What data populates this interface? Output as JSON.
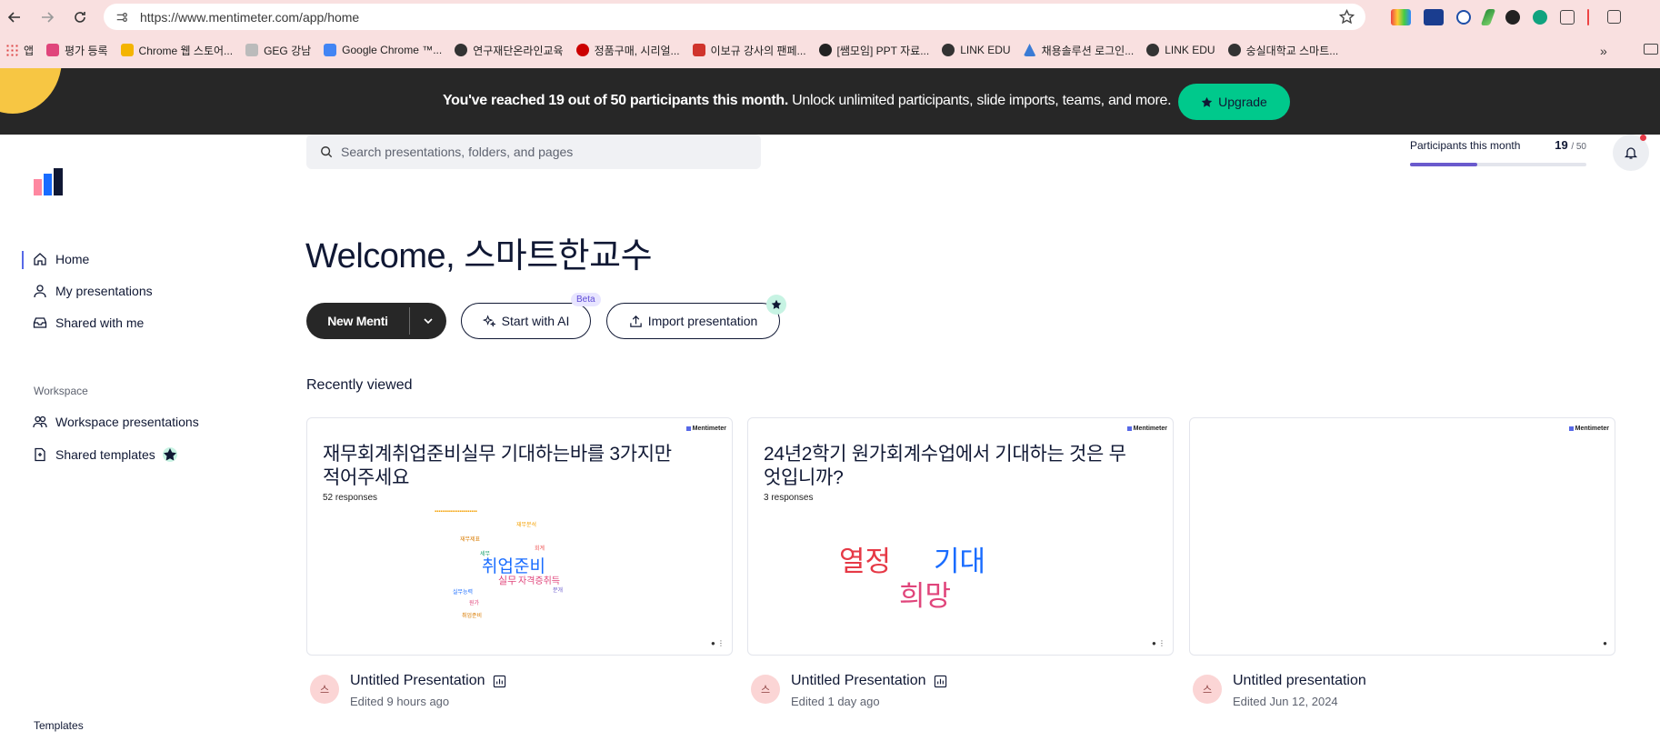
{
  "browser": {
    "url": "https://www.mentimeter.com/app/home",
    "bookmarks": [
      {
        "label": "앱",
        "color": "#d44"
      },
      {
        "label": "평가 등록",
        "color": "#e0457b"
      },
      {
        "label": "Chrome 웹 스토어...",
        "color": "#f4b400"
      },
      {
        "label": "GEG 강남",
        "color": "#bbbbbb"
      },
      {
        "label": "Google Chrome ™...",
        "color": "#4285f4"
      },
      {
        "label": "연구재단온라인교육",
        "color": "#333333"
      },
      {
        "label": "정품구매, 시리얼...",
        "color": "#cc0000"
      },
      {
        "label": "이보규 강사의 팬페...",
        "color": "#d0342c"
      },
      {
        "label": "[쌤모임] PPT 자료...",
        "color": "#222222"
      },
      {
        "label": "LINK EDU",
        "color": "#333333"
      },
      {
        "label": "채용솔루션 로그인...",
        "color": "#3a7bd5"
      },
      {
        "label": "LINK EDU",
        "color": "#333333"
      },
      {
        "label": "숭실대학교 스마트...",
        "color": "#333333"
      }
    ],
    "more_label": "»"
  },
  "banner": {
    "message_bold": "You've reached 19 out of 50 participants this month.",
    "message_rest": " Unlock unlimited participants, slide imports, teams, and more.",
    "upgrade_label": "Upgrade"
  },
  "sidebar": {
    "items": [
      {
        "label": "Home",
        "icon": "home-icon"
      },
      {
        "label": "My presentations",
        "icon": "user-icon"
      },
      {
        "label": "Shared with me",
        "icon": "inbox-icon"
      }
    ],
    "workspace_heading": "Workspace",
    "workspace_items": [
      {
        "label": "Workspace presentations",
        "icon": "users-icon"
      },
      {
        "label": "Shared templates",
        "icon": "document-icon"
      }
    ],
    "templates_heading": "Templates"
  },
  "search": {
    "placeholder": "Search presentations, folders, and pages"
  },
  "participants": {
    "label": "Participants this month",
    "count": "19",
    "limit": "/ 50",
    "fraction": 0.38
  },
  "main": {
    "welcome": "Welcome, 스마트한교수",
    "new_menti_label": "New Menti",
    "start_ai_label": "Start with AI",
    "beta_label": "Beta",
    "import_label": "Import presentation",
    "recently_viewed": "Recently viewed"
  },
  "brand_label": "Mentimeter",
  "cards": [
    {
      "question": "재무회계취업준비실무 기대하는바를 3가지만 적어주세요",
      "responses": "52 responses",
      "title": "Untitled Presentation",
      "edited": "Edited 9 hours ago",
      "avatar": "스",
      "cloud_main": "취업준비",
      "cloud_words": [
        "실무",
        "자격증취득",
        "재무제표",
        "회계",
        "세무",
        "실무능력",
        "분개",
        "원가",
        "재무분석",
        "취업준비"
      ]
    },
    {
      "question": "24년2학기 원가회계수업에서 기대하는 것은 무엇입니까?",
      "responses": "3 responses",
      "title": "Untitled Presentation",
      "edited": "Edited 1 day ago",
      "avatar": "스",
      "words": [
        "열정",
        "기대",
        "희망"
      ]
    },
    {
      "question": "",
      "responses": "",
      "title": "Untitled presentation",
      "edited": "Edited Jun 12, 2024",
      "avatar": "스"
    }
  ],
  "colors": {
    "accent": "#00c98c",
    "banner_bg": "#272727",
    "progress": "#6a5acd"
  }
}
